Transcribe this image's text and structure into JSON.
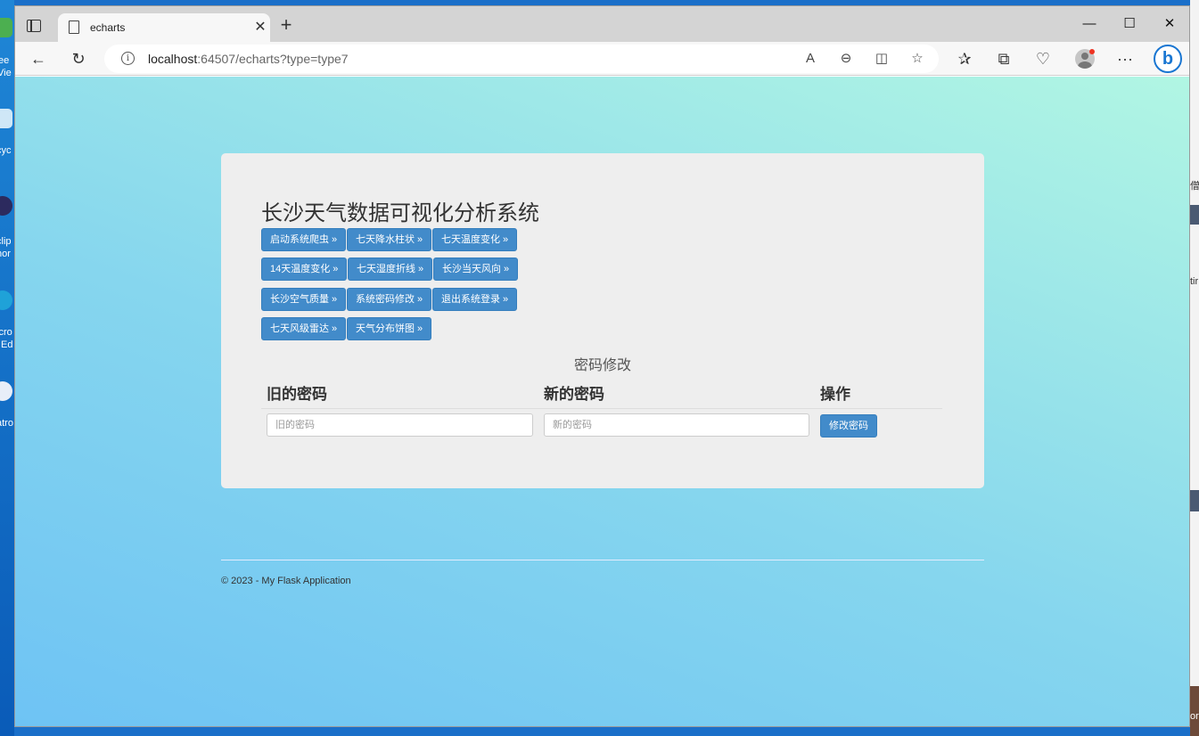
{
  "desktop": {
    "left_labels": [
      "ee",
      "Vie",
      "cyc",
      "clip",
      "hor",
      "icro",
      "Ed",
      "atro"
    ],
    "right_labels": [
      "僧",
      "tir",
      "or"
    ]
  },
  "browser": {
    "tab": {
      "title": "echarts"
    },
    "window_controls": {
      "minimize": "—",
      "maximize": "☐",
      "close": "✕"
    },
    "address": {
      "host": "localhost",
      "rest": ":64507/echarts?type=type7"
    }
  },
  "page": {
    "title": "长沙天气数据可视化分析系统",
    "nav_buttons": [
      "启动系统爬虫 »",
      "七天降水柱状 »",
      "七天温度变化 »",
      "14天温度变化 »",
      "七天湿度折线 »",
      "长沙当天风向 »",
      "长沙空气质量 »",
      "系统密码修改 »",
      "退出系统登录 »",
      "七天风级雷达 »",
      "天气分布饼图 »"
    ],
    "section_title": "密码修改",
    "table": {
      "headers": [
        "旧的密码",
        "新的密码",
        "操作"
      ],
      "old_placeholder": "旧的密码",
      "new_placeholder": "新的密码",
      "submit_label": "修改密码"
    },
    "footer": "© 2023 - My Flask Application"
  },
  "colors": {
    "button": "#428bca",
    "panel": "#eeeeee"
  }
}
